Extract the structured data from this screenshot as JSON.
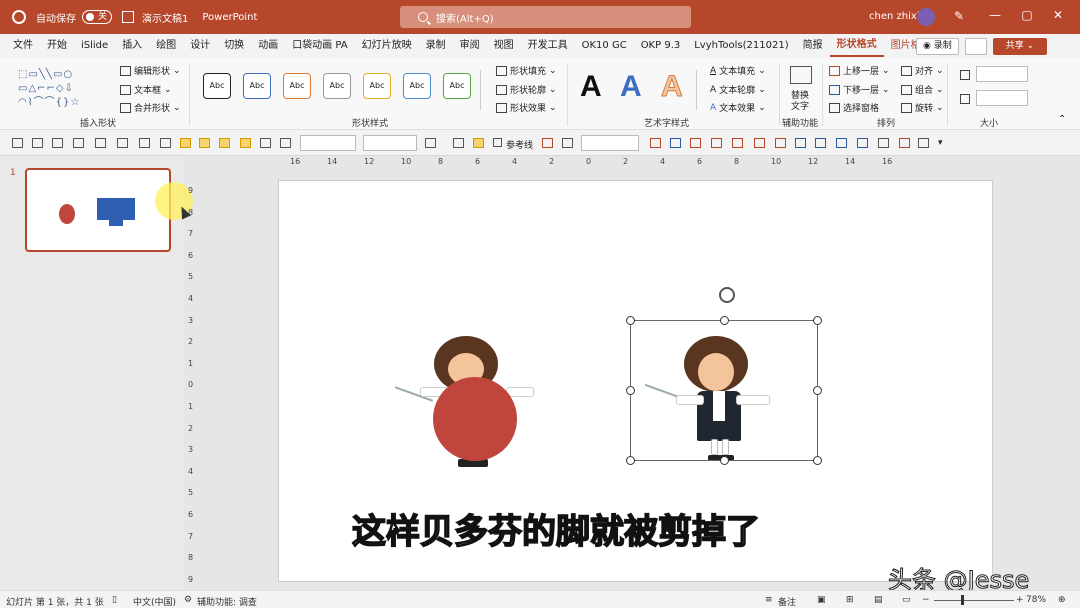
{
  "titlebar": {
    "autosave_label": "自动保存",
    "autosave_state": "关",
    "doc_name": "演示文稿1",
    "app_name": "PowerPoint",
    "search_placeholder": "搜索(Alt+Q)",
    "user_name": "chen zhixi",
    "minimize": "—",
    "restore": "▢",
    "close": "✕"
  },
  "tabs": [
    "文件",
    "开始",
    "iSlide",
    "插入",
    "绘图",
    "设计",
    "切换",
    "动画",
    "口袋动画 PA",
    "幻灯片放映",
    "录制",
    "审阅",
    "视图",
    "开发工具",
    "OK10 GC",
    "OKP 9.3",
    "LvyhTools(211021)",
    "简报",
    "形状格式",
    "图片格式"
  ],
  "tab_active": "形状格式",
  "tab_context": "图片格式",
  "actions": {
    "record": "◉ 录制",
    "share": "共享 ⌄"
  },
  "ribbon": {
    "insert_shapes": {
      "label": "插入形状",
      "shapes_glyphs": "⬚▭╲╲▭○\n▭△⌐⌐◇⇩\n◠⌇⌒⌒{ }☆",
      "edit_shape": "编辑形状",
      "textbox": "文本框",
      "merge_shapes": "合并形状"
    },
    "shape_styles": {
      "label": "形状样式",
      "abc": "Abc",
      "fill": "形状填充",
      "outline": "形状轮廓",
      "effect": "形状效果"
    },
    "wordart": {
      "label": "艺术字样式",
      "A": "A",
      "text_fill": "文本填充",
      "text_outline": "文本轮廓",
      "text_effect": "文本效果"
    },
    "accessibility": {
      "label": "辅助功能",
      "alt_text_1": "替换",
      "alt_text_2": "文字"
    },
    "arrange": {
      "label": "排列",
      "bring_forward": "上移一层",
      "send_backward": "下移一层",
      "selection_pane": "选择窗格",
      "align": "对齐",
      "group": "组合",
      "rotate": "旋转"
    },
    "size": {
      "label": "大小"
    }
  },
  "toolbar2": {
    "reference_line": "参考线"
  },
  "thumbnails": {
    "slide_number": "1"
  },
  "ruler_h": [
    "16",
    "14",
    "12",
    "10",
    "8",
    "6",
    "4",
    "2",
    "0",
    "2",
    "4",
    "6",
    "8",
    "10",
    "12",
    "14",
    "16"
  ],
  "ruler_v": [
    "9",
    "8",
    "7",
    "6",
    "5",
    "4",
    "3",
    "2",
    "1",
    "0",
    "1",
    "2",
    "3",
    "4",
    "5",
    "6",
    "7",
    "8",
    "9"
  ],
  "subtitle": "这样贝多芬的脚就被剪掉了",
  "watermark": "头条 @Jesse",
  "status": {
    "slide_info": "幻灯片 第 1 张，共 1 张",
    "language": "中文(中国)",
    "accessibility": "辅助功能: 调查",
    "notes": "备注",
    "zoom": "78%"
  },
  "colors": {
    "accent": "#b7472a",
    "shape_red": "#c0463d",
    "shape_blue": "#2f5fb3"
  }
}
